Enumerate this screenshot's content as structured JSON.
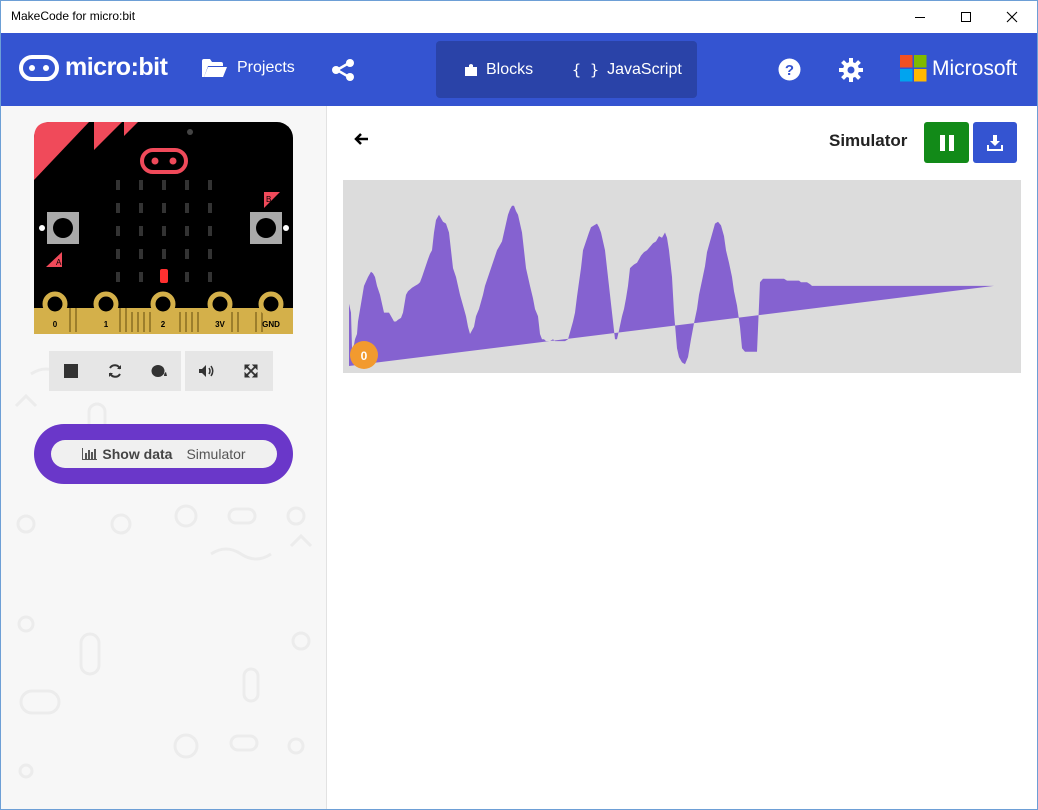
{
  "window": {
    "title": "MakeCode for micro:bit"
  },
  "header": {
    "logo_text": "micro:bit",
    "projects_label": "Projects",
    "blocks_label": "Blocks",
    "javascript_label": "JavaScript",
    "microsoft_label": "Microsoft"
  },
  "simulator": {
    "pins": [
      "0",
      "1",
      "2",
      "3V",
      "GND"
    ],
    "button_a": "A",
    "button_b": "B",
    "show_data_label": "Show data",
    "show_data_sub": "Simulator"
  },
  "data_view": {
    "title": "Simulator",
    "series_badge": "0"
  },
  "colors": {
    "header_blue": "#3454d1",
    "accent_purple": "#6a37c9",
    "area_fill": "#8562d0",
    "pause_green": "#128a18",
    "badge_orange": "#f29a2e"
  },
  "chart_data": {
    "type": "area",
    "ylim": [
      0,
      1
    ],
    "x": [
      0,
      2,
      3,
      5,
      6,
      8,
      9,
      12,
      15,
      19,
      22,
      24,
      26,
      28,
      31,
      33,
      35,
      37,
      40,
      43,
      45,
      47,
      49,
      52,
      54,
      57,
      59,
      61,
      63,
      66,
      69,
      71,
      73,
      76,
      79,
      81,
      83,
      85,
      87,
      90,
      92,
      94,
      97,
      100,
      102,
      104,
      107,
      109,
      111,
      113,
      115,
      117,
      119,
      121,
      123,
      125,
      127,
      130,
      132,
      134,
      136,
      139,
      142,
      145,
      148,
      151,
      153,
      155,
      157,
      159,
      161,
      163,
      165,
      167,
      169,
      171,
      173,
      175,
      177,
      179,
      181,
      184,
      186,
      189,
      191,
      193,
      195,
      197,
      199,
      201,
      204,
      206,
      208,
      210,
      212,
      214,
      216,
      219,
      221,
      224,
      226,
      228,
      230,
      232,
      234,
      237,
      240,
      242,
      245,
      248,
      250,
      252,
      254,
      256,
      258,
      260,
      262,
      264,
      266,
      268,
      270,
      273,
      275,
      277,
      279,
      281,
      283,
      285,
      288,
      290,
      292,
      295,
      298,
      301,
      304,
      307,
      310,
      313,
      316,
      318,
      320,
      323,
      325,
      328,
      330,
      333,
      336,
      339,
      342,
      345,
      348,
      350,
      353,
      356,
      358,
      361,
      364,
      366,
      369,
      372,
      375,
      377,
      380,
      383,
      385,
      388,
      391,
      393,
      396,
      399,
      402,
      405,
      408,
      411,
      414,
      417,
      420,
      423,
      426,
      429,
      432,
      435,
      438,
      441,
      444,
      447,
      450,
      452,
      455,
      458,
      461,
      463,
      466,
      469,
      472,
      475,
      478,
      481,
      484,
      487,
      490,
      492,
      495,
      498,
      500,
      503,
      506,
      509,
      512,
      515,
      518,
      521,
      524,
      527,
      530,
      533,
      536,
      539,
      542,
      545,
      548,
      551,
      554,
      556,
      559,
      562,
      565,
      568,
      571,
      573,
      576,
      579,
      582,
      585,
      588,
      591,
      594,
      597,
      600,
      603,
      606,
      609,
      612,
      615,
      618,
      621,
      624,
      627,
      630,
      633,
      636,
      639,
      642,
      645,
      648,
      651,
      654,
      657,
      660,
      663,
      665
    ],
    "y": [
      0.35,
      0.3,
      0.1,
      0.12,
      0.15,
      0.18,
      0.25,
      0.35,
      0.45,
      0.5,
      0.53,
      0.52,
      0.5,
      0.45,
      0.4,
      0.35,
      0.3,
      0.3,
      0.3,
      0.27,
      0.25,
      0.25,
      0.26,
      0.27,
      0.3,
      0.4,
      0.42,
      0.43,
      0.44,
      0.45,
      0.46,
      0.47,
      0.5,
      0.55,
      0.6,
      0.63,
      0.65,
      0.75,
      0.82,
      0.85,
      0.83,
      0.81,
      0.8,
      0.75,
      0.65,
      0.55,
      0.5,
      0.45,
      0.4,
      0.36,
      0.32,
      0.28,
      0.22,
      0.18,
      0.2,
      0.22,
      0.28,
      0.32,
      0.36,
      0.4,
      0.45,
      0.5,
      0.55,
      0.6,
      0.65,
      0.68,
      0.7,
      0.75,
      0.8,
      0.85,
      0.88,
      0.9,
      0.9,
      0.87,
      0.85,
      0.8,
      0.75,
      0.65,
      0.55,
      0.5,
      0.45,
      0.38,
      0.32,
      0.28,
      0.18,
      0.15,
      0.15,
      0.14,
      0.14,
      0.14,
      0.15,
      0.14,
      0.14,
      0.14,
      0.14,
      0.14,
      0.14,
      0.15,
      0.19,
      0.25,
      0.3,
      0.39,
      0.47,
      0.55,
      0.65,
      0.7,
      0.75,
      0.78,
      0.79,
      0.8,
      0.78,
      0.75,
      0.7,
      0.65,
      0.55,
      0.45,
      0.35,
      0.25,
      0.15,
      0.15,
      0.2,
      0.28,
      0.32,
      0.38,
      0.45,
      0.55,
      0.56,
      0.57,
      0.58,
      0.6,
      0.62,
      0.64,
      0.65,
      0.67,
      0.69,
      0.7,
      0.73,
      0.72,
      0.75,
      0.72,
      0.65,
      0.5,
      0.3,
      0.1,
      0.05,
      0.02,
      0.01,
      0.05,
      0.15,
      0.24,
      0.32,
      0.4,
      0.48,
      0.56,
      0.64,
      0.7,
      0.76,
      0.8,
      0.81,
      0.79,
      0.73,
      0.65,
      0.58,
      0.5,
      0.42,
      0.34,
      0.22,
      0.1,
      0.08,
      0.08,
      0.08,
      0.08,
      0.08,
      0.47,
      0.49,
      0.49,
      0.49,
      0.49,
      0.49,
      0.49,
      0.49,
      0.49,
      0.48,
      0.48,
      0.48,
      0.48,
      0.48,
      0.47,
      0.47,
      0.47,
      0.46,
      0.45,
      0.45,
      0.45,
      0.45,
      0.45,
      0.45,
      0.45,
      0.45,
      0.45,
      0.45,
      0.45,
      0.45,
      0.45,
      0.45,
      0.45,
      0.45,
      0.45,
      0.45,
      0.45,
      0.45,
      0.45,
      0.45,
      0.45,
      0.45,
      0.45,
      0.45,
      0.45,
      0.45,
      0.45,
      0.45,
      0.45,
      0.45,
      0.45,
      0.45,
      0.45,
      0.45,
      0.45,
      0.45,
      0.45,
      0.45,
      0.45,
      0.45,
      0.45,
      0.45,
      0.45,
      0.45,
      0.45,
      0.45,
      0.45,
      0.45,
      0.45,
      0.45,
      0.45,
      0.45,
      0.45,
      0.45,
      0.45,
      0.45,
      0.45,
      0.45,
      0.45,
      0.45,
      0.45
    ]
  }
}
